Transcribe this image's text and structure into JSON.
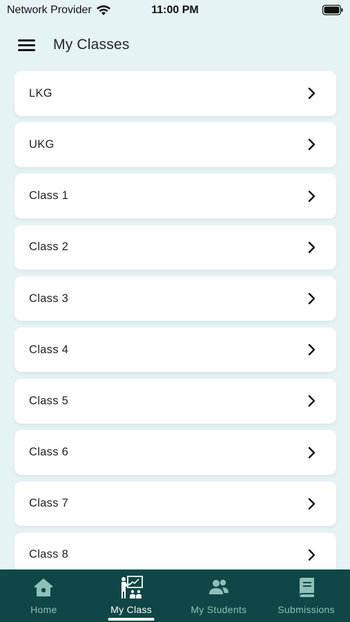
{
  "status_bar": {
    "carrier": "Network Provider",
    "time": "11:00 PM"
  },
  "header": {
    "title": "My Classes",
    "menu_icon": "hamburger-menu-icon"
  },
  "classes": [
    {
      "label": "LKG"
    },
    {
      "label": "UKG"
    },
    {
      "label": "Class 1"
    },
    {
      "label": "Class 2"
    },
    {
      "label": "Class 3"
    },
    {
      "label": "Class 4"
    },
    {
      "label": "Class 5"
    },
    {
      "label": "Class 6"
    },
    {
      "label": "Class 7"
    },
    {
      "label": "Class 8"
    }
  ],
  "bottom_nav": {
    "active": "My Class",
    "items": [
      {
        "label": "Home",
        "icon": "home-icon"
      },
      {
        "label": "My Class",
        "icon": "teacher-board-icon"
      },
      {
        "label": "My Students",
        "icon": "students-icon"
      },
      {
        "label": "Submissions",
        "icon": "book-icon"
      }
    ]
  },
  "colors": {
    "background": "#e6f3f4",
    "card": "#ffffff",
    "nav_background": "#0e4745",
    "nav_inactive": "#8fbfb9",
    "nav_active": "#ffffff"
  }
}
